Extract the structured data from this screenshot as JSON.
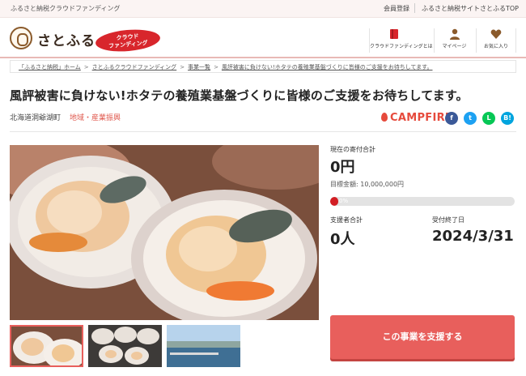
{
  "topbar": {
    "tagline": "ふるさと納税クラウドファンディング",
    "member": "会員登録",
    "site": "ふるさと納税サイトさとふるTOP"
  },
  "header": {
    "logo_text": "さとふる",
    "badge_line1": "クラウド",
    "badge_line2": "ファンディング",
    "nav": [
      {
        "label": "クラウドファンディングとは",
        "icon": "book-icon"
      },
      {
        "label": "マイページ",
        "icon": "person-icon"
      },
      {
        "label": "お気に入り",
        "icon": "heart-icon"
      }
    ]
  },
  "breadcrumb": [
    "「ふるさと納税」ホーム",
    "さとふるクラウドファンディング",
    "事業一覧",
    "風評被害に負けない!ホタテの養殖業基盤づくりに皆様のご支援をお待ちしてます。"
  ],
  "project": {
    "title": "風評被害に負けない!ホタテの養殖業基盤づくりに皆様のご支援をお待ちしてます。",
    "location": "北海道洞爺湖町",
    "category": "地域・産業振興",
    "platform": "CAMPFIRE"
  },
  "sns": [
    {
      "label": "f",
      "name": "facebook-icon",
      "color": "#3b5998"
    },
    {
      "label": "t",
      "name": "twitter-icon",
      "color": "#1da1f2"
    },
    {
      "label": "L",
      "name": "line-icon",
      "color": "#06c755"
    },
    {
      "label": "B!",
      "name": "hatena-icon",
      "color": "#00a4de"
    }
  ],
  "stats": {
    "current_label": "現在の寄付合計",
    "current_value": "0円",
    "goal_label": "目標金額: 10,000,000円",
    "progress_percent": 0,
    "progress_text": "0%",
    "supporters_label": "支援者合計",
    "supporters_value": "0人",
    "end_label": "受付終了日",
    "end_value": "2024/3/31"
  },
  "cta": {
    "support_label": "この事業を支援する"
  },
  "colors": {
    "accent": "#e85f5c",
    "brand_red": "#d8262c",
    "campfire": "#e64a3c",
    "progress": "#d21e24"
  }
}
